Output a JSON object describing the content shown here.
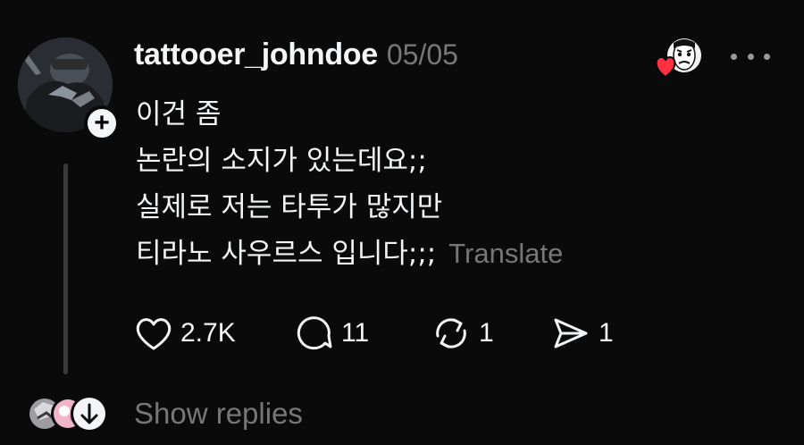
{
  "post": {
    "username": "tattooer_johndoe",
    "date": "05/05",
    "lines": [
      "이건 좀",
      "논란의 소지가 있는데요;;",
      "실제로 저는 타투가 많지만",
      "티라노 사우르스 입니다;;;"
    ],
    "translate_label": "Translate"
  },
  "actions": {
    "likes": "2.7K",
    "replies": "11",
    "reposts": "1",
    "shares": "1"
  },
  "footer": {
    "show_replies_label": "Show replies"
  },
  "icons": {
    "follow": "plus-icon",
    "more": "more-horizontal-icon",
    "like": "heart-icon",
    "reply": "speech-bubble-icon",
    "repost": "repost-icon",
    "share": "send-icon",
    "replies_expand": "arrow-down-icon",
    "liked_by_heart": "heart-icon"
  },
  "colors": {
    "background": "#0a0a0a",
    "primary_text": "#f3f5f7",
    "secondary_text": "#777777",
    "thread_line": "#3a3a3a",
    "like_red": "#ff3040"
  }
}
